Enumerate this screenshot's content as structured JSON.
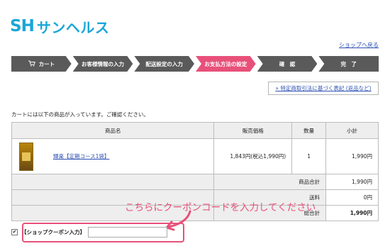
{
  "brand": {
    "mark": "SH",
    "name": "サンヘルス"
  },
  "header": {
    "back_link": "ショップへ戻る"
  },
  "steps": [
    {
      "label": "カート",
      "icon": "cart-icon",
      "active": false
    },
    {
      "label": "お客様情報の入力",
      "active": false
    },
    {
      "label": "配送設定の入力",
      "active": false
    },
    {
      "label": "お支払方法の設定",
      "active": true
    },
    {
      "label": "確　認",
      "active": false
    },
    {
      "label": "完　了",
      "active": false
    }
  ],
  "law_link": "» 特定商取引法に基づく表記 (返品など)",
  "intro": "カートには以下の商品が入っています。ご確認ください。",
  "table": {
    "headers": {
      "item": "商品名",
      "price": "販売価格",
      "qty": "数量",
      "subtotal": "小計"
    },
    "items": [
      {
        "name": "輝楽【定期コース1袋】",
        "price": "1,843円(税込1,990円)",
        "qty": "1",
        "subtotal": "1,990円"
      }
    ],
    "summary": {
      "item_total_label": "商品合計",
      "item_total": "1,990円",
      "shipping_label": "送料",
      "shipping": "0円",
      "grand_total_label": "総合計",
      "grand_total": "1,990円"
    }
  },
  "annotation": "こちらにクーポンコードを入力してください",
  "coupon": {
    "checkbox": "✔",
    "label": "【ショップクーポン入力】",
    "value": ""
  },
  "colors": {
    "brand": "#1aa6d9",
    "active_step": "#e8507a",
    "step": "#5a5a5a",
    "annotation": "#e8507a",
    "link": "#2b4fb3"
  }
}
